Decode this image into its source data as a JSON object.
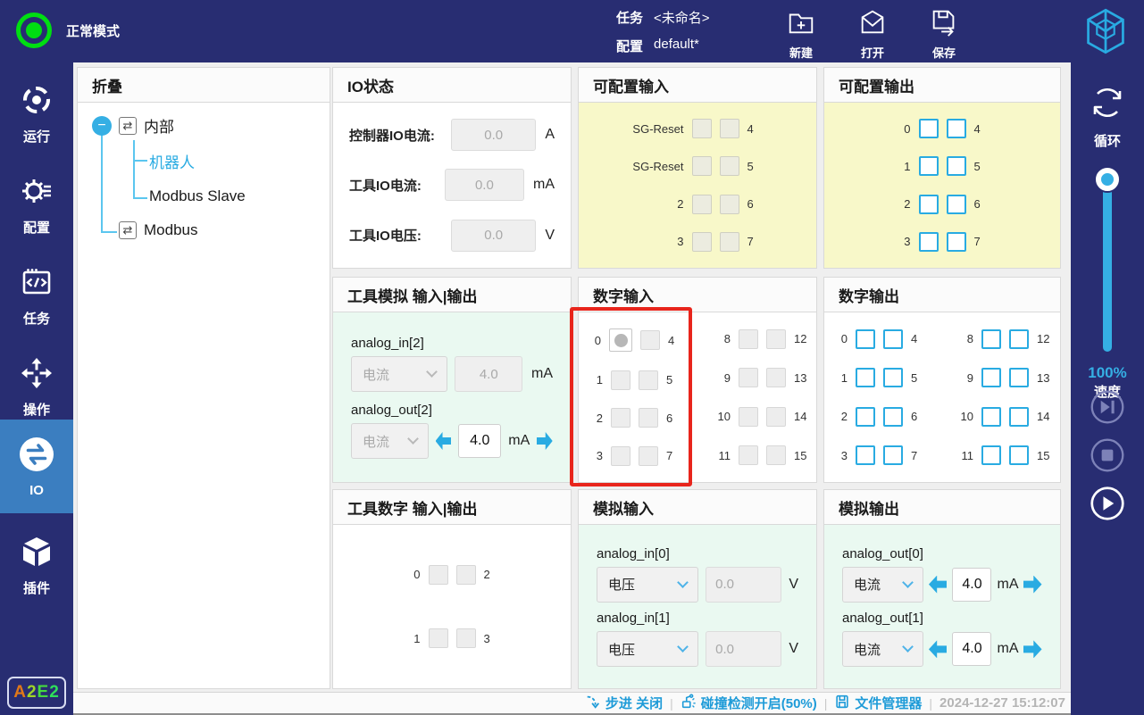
{
  "topbar": {
    "mode_label": "正常模式",
    "task_label": "任务",
    "task_value": "<未命名>",
    "config_label": "配置",
    "config_value": "default*",
    "actions": [
      {
        "label": "新建"
      },
      {
        "label": "打开"
      },
      {
        "label": "保存"
      }
    ]
  },
  "sidebar": {
    "items": [
      {
        "label": "运行"
      },
      {
        "label": "配置"
      },
      {
        "label": "任务"
      },
      {
        "label": "操作"
      },
      {
        "label": "IO",
        "active": true
      },
      {
        "label": "插件"
      }
    ],
    "badge_letters": [
      {
        "ch": "A"
      },
      {
        "ch": "2"
      },
      {
        "ch": "E"
      },
      {
        "ch": "2"
      }
    ]
  },
  "tree": {
    "header": "折叠",
    "collapse_glyph": "−",
    "node_icon_glyph": "⇄",
    "root": "内部",
    "child_robot": "机器人",
    "child_modbus_slave": "Modbus Slave",
    "sibling_modbus": "Modbus"
  },
  "io_status": {
    "title": "IO状态",
    "rows": [
      {
        "label": "控制器IO电流:",
        "value": "0.0",
        "unit": "A"
      },
      {
        "label": "工具IO电流:",
        "value": "0.0",
        "unit": "mA"
      },
      {
        "label": "工具IO电压:",
        "value": "0.0",
        "unit": "V"
      }
    ]
  },
  "configurable_input": {
    "title": "可配置输入",
    "rows": [
      {
        "l": "SG-Reset",
        "r": "4"
      },
      {
        "l": "SG-Reset",
        "r": "5"
      },
      {
        "l": "2",
        "r": "6"
      },
      {
        "l": "3",
        "r": "7"
      }
    ]
  },
  "configurable_output": {
    "title": "可配置输出",
    "rows": [
      {
        "l": "0",
        "r": "4"
      },
      {
        "l": "1",
        "r": "5"
      },
      {
        "l": "2",
        "r": "6"
      },
      {
        "l": "3",
        "r": "7"
      }
    ]
  },
  "tool_analog": {
    "title": "工具模拟 输入|输出",
    "in_label": "analog_in[2]",
    "in_select": "电流",
    "in_value": "4.0",
    "in_unit": "mA",
    "out_label": "analog_out[2]",
    "out_select": "电流",
    "out_value": "4.0",
    "out_unit": "mA"
  },
  "digital_input": {
    "title": "数字输入",
    "groups": [
      {
        "rows": [
          {
            "l": "0",
            "r": "4",
            "indicator": "dot"
          },
          {
            "l": "1",
            "r": "5"
          },
          {
            "l": "2",
            "r": "6"
          },
          {
            "l": "3",
            "r": "7"
          }
        ]
      },
      {
        "rows": [
          {
            "l": "8",
            "r": "12"
          },
          {
            "l": "9",
            "r": "13"
          },
          {
            "l": "10",
            "r": "14"
          },
          {
            "l": "11",
            "r": "15"
          }
        ]
      }
    ]
  },
  "digital_output": {
    "title": "数字输出",
    "groups": [
      {
        "rows": [
          {
            "l": "0",
            "r": "4"
          },
          {
            "l": "1",
            "r": "5"
          },
          {
            "l": "2",
            "r": "6"
          },
          {
            "l": "3",
            "r": "7"
          }
        ]
      },
      {
        "rows": [
          {
            "l": "8",
            "r": "12"
          },
          {
            "l": "9",
            "r": "13"
          },
          {
            "l": "10",
            "r": "14"
          },
          {
            "l": "11",
            "r": "15"
          }
        ]
      }
    ]
  },
  "tool_digital": {
    "title": "工具数字 输入|输出",
    "rows": [
      {
        "l": "0",
        "r": "2"
      },
      {
        "l": "1",
        "r": "3"
      }
    ]
  },
  "analog_input": {
    "title": "模拟输入",
    "channels": [
      {
        "label": "analog_in[0]",
        "select": "电压",
        "value": "0.0",
        "unit": "V"
      },
      {
        "label": "analog_in[1]",
        "select": "电压",
        "value": "0.0",
        "unit": "V"
      }
    ]
  },
  "analog_output": {
    "title": "模拟输出",
    "channels": [
      {
        "label": "analog_out[0]",
        "select": "电流",
        "value": "4.0",
        "unit": "mA"
      },
      {
        "label": "analog_out[1]",
        "select": "电流",
        "value": "4.0",
        "unit": "mA"
      }
    ]
  },
  "right_sidebar": {
    "loop_label": "循环",
    "speed_percent": "100%",
    "speed_label": "速度"
  },
  "statusbar": {
    "step": "步进 关闭",
    "collision": "碰撞检测开启(50%)",
    "file_manager": "文件管理器",
    "timestamp": "2024-12-27 15:12:07",
    "separator": "|"
  },
  "colors": {
    "navy": "#282D72",
    "active_blue": "#3B7EC0",
    "accent_cyan": "#29ABE2",
    "panel_yellow": "#F8F8C9",
    "panel_mint": "#EAF9F1",
    "highlight_red": "#E8251C",
    "status_green": "#00DE12"
  }
}
